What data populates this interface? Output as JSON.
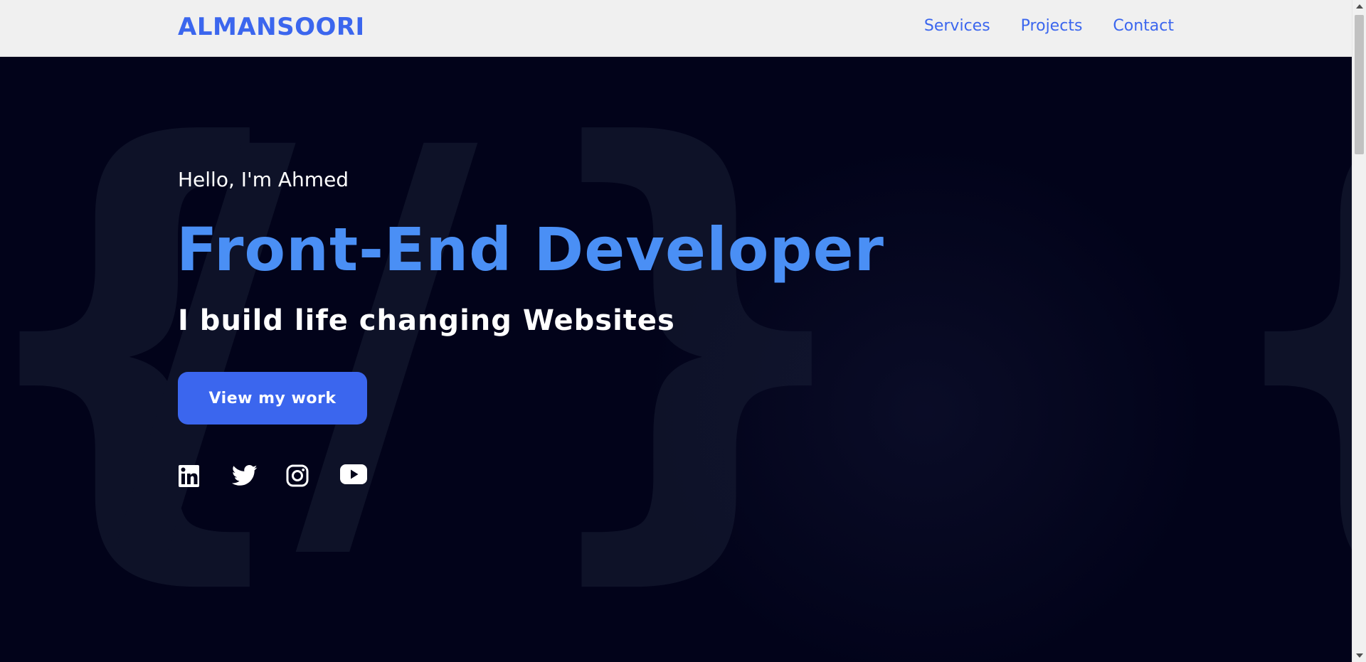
{
  "header": {
    "logo": "ALMANSOORI",
    "nav": [
      {
        "label": "Services"
      },
      {
        "label": "Projects"
      },
      {
        "label": "Contact"
      }
    ]
  },
  "hero": {
    "greeting": "Hello, I'm Ahmed",
    "headline": "Front-End Developer",
    "subhead": "I build life changing Websites",
    "cta_label": "View my work",
    "background_glyphs": [
      "{",
      "//",
      "}",
      "{"
    ],
    "socials": [
      {
        "icon": "linkedin-icon"
      },
      {
        "icon": "twitter-icon"
      },
      {
        "icon": "instagram-icon"
      },
      {
        "icon": "youtube-icon"
      }
    ]
  },
  "colors": {
    "brand_blue": "#3b66ee",
    "headline_blue": "#4a8ff5",
    "hero_background": "#02031a",
    "header_background": "#f0f0f0"
  }
}
